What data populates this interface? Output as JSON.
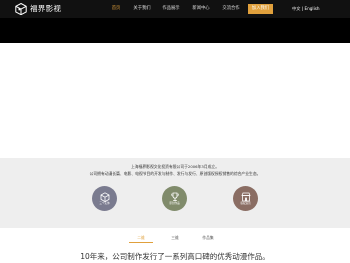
{
  "header": {
    "brand": "福界影视",
    "logo_icon": "cube-logo-icon",
    "nav": [
      {
        "label": "首页",
        "active": true
      },
      {
        "label": "关于我们",
        "active": false
      },
      {
        "label": "作品展示",
        "active": false
      },
      {
        "label": "新闻中心",
        "active": false
      },
      {
        "label": "交流合作",
        "active": false
      }
    ],
    "join_button": "加入我们",
    "lang": {
      "zh": "中文",
      "separator": " | ",
      "en": "English"
    }
  },
  "about": {
    "line1": "上海福界影视文化投资有限公司于2006年3月成立。",
    "line2": "公司拥有动漫长篇、电影、电视节目的开发与制作、发行与发行、原创版权授权销售的综合产业生态。",
    "features": [
      {
        "label": "三个实体",
        "icon": "cube-icon"
      },
      {
        "label": "原创作品",
        "icon": "trophy-icon"
      },
      {
        "label": "版权运营",
        "icon": "store-icon"
      }
    ]
  },
  "tabs": [
    {
      "label": "二维",
      "active": true
    },
    {
      "label": "三维",
      "active": false
    },
    {
      "label": "作品集",
      "active": false
    }
  ],
  "headline": "10年来，公司制作发行了一系列高口碑的优秀动漫作品。",
  "colors": {
    "accent": "#e0a03c",
    "header_bg": "#111111",
    "section_bg": "#eeeeee"
  }
}
